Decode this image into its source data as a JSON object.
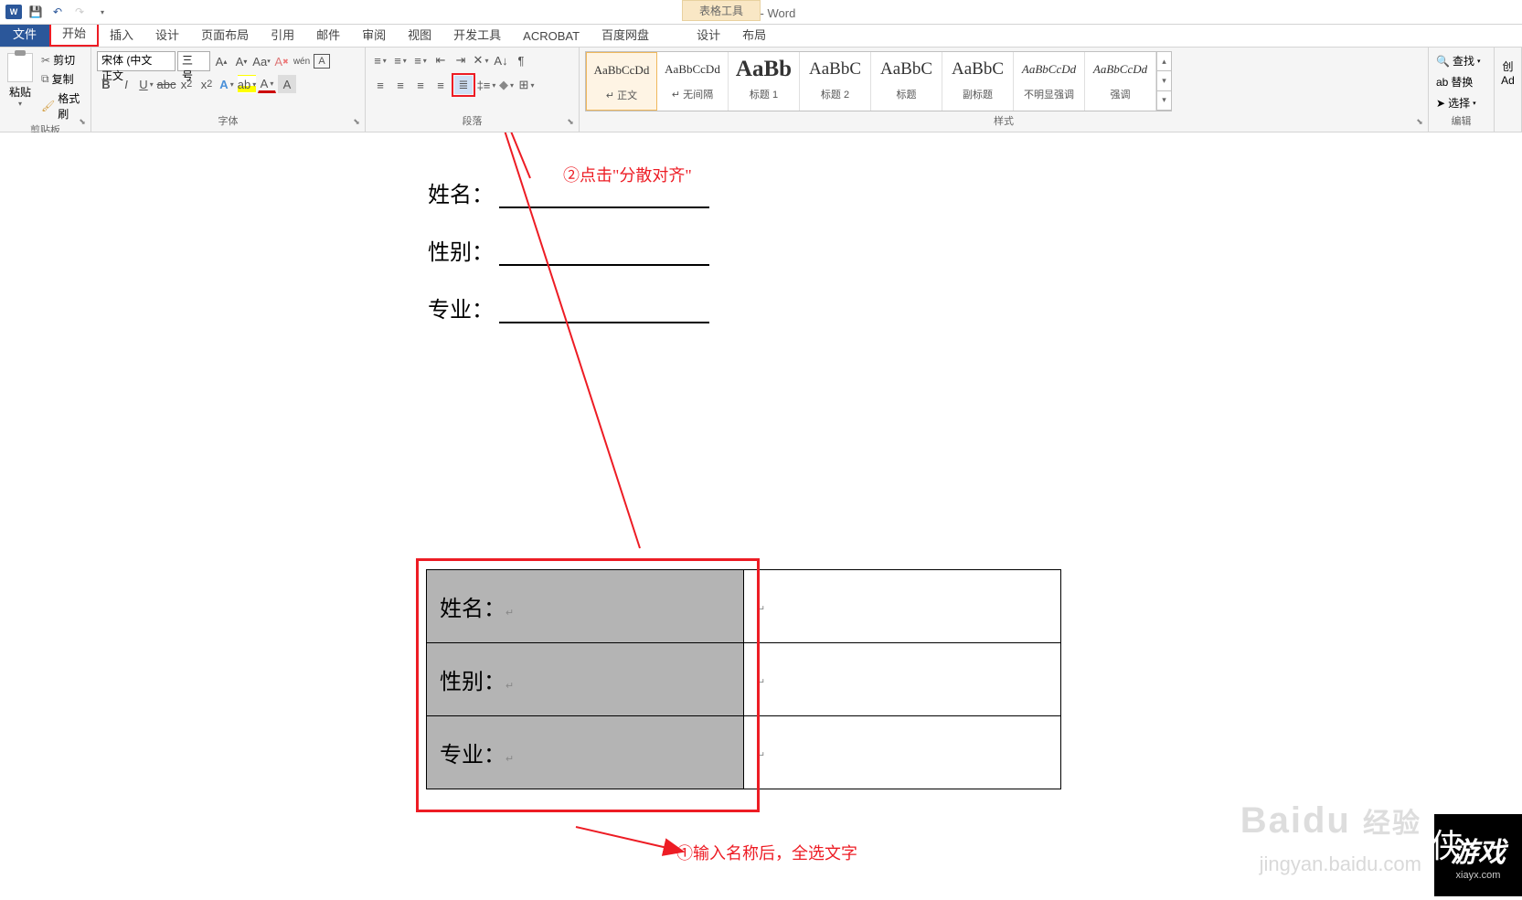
{
  "title": "文档1 - Word",
  "contextual_tab": "表格工具",
  "tabs": {
    "file": "文件",
    "home": "开始",
    "insert": "插入",
    "design": "设计",
    "layout": "页面布局",
    "references": "引用",
    "mailings": "邮件",
    "review": "审阅",
    "view": "视图",
    "developer": "开发工具",
    "acrobat": "ACROBAT",
    "baidu": "百度网盘",
    "table_design": "设计",
    "table_layout": "布局"
  },
  "clipboard": {
    "paste": "粘贴",
    "cut": "剪切",
    "copy": "复制",
    "format_painter": "格式刷",
    "group_label": "剪贴板"
  },
  "font": {
    "name": "宋体 (中文正文",
    "size": "三号",
    "group_label": "字体"
  },
  "paragraph": {
    "group_label": "段落"
  },
  "styles": {
    "group_label": "样式",
    "items": [
      {
        "preview": "AaBbCcDd",
        "name": "↵ 正文",
        "size": "13px",
        "selected": true
      },
      {
        "preview": "AaBbCcDd",
        "name": "↵ 无间隔",
        "size": "13px"
      },
      {
        "preview": "AaBb",
        "name": "标题 1",
        "size": "25px",
        "bold": true
      },
      {
        "preview": "AaBbC",
        "name": "标题 2",
        "size": "19px"
      },
      {
        "preview": "AaBbC",
        "name": "标题",
        "size": "19px"
      },
      {
        "preview": "AaBbC",
        "name": "副标题",
        "size": "19px"
      },
      {
        "preview": "AaBbCcDd",
        "name": "不明显强调",
        "size": "13px",
        "italic": true
      },
      {
        "preview": "AaBbCcDd",
        "name": "强调",
        "size": "13px",
        "italic": true
      }
    ]
  },
  "editing": {
    "find": "查找",
    "replace": "替换",
    "select": "选择",
    "group_label": "编辑"
  },
  "last_group": {
    "label": "创",
    "sub": "Ad"
  },
  "document": {
    "lines": [
      {
        "label": "姓名："
      },
      {
        "label": "性别："
      },
      {
        "label": "专业："
      }
    ],
    "table": [
      {
        "label": "姓名：",
        "value": ""
      },
      {
        "label": "性别：",
        "value": ""
      },
      {
        "label": "专业：",
        "value": ""
      }
    ]
  },
  "annotations": {
    "step1": "①输入名称后，全选文字",
    "step2": "②点击\"分散对齐\""
  },
  "watermark": {
    "brand": "Baidu",
    "brand_suffix": "经验",
    "url": "jingyan.baidu.com",
    "corner_main": "游戏",
    "corner_side": "侠",
    "corner_url": "xiayx.com"
  }
}
